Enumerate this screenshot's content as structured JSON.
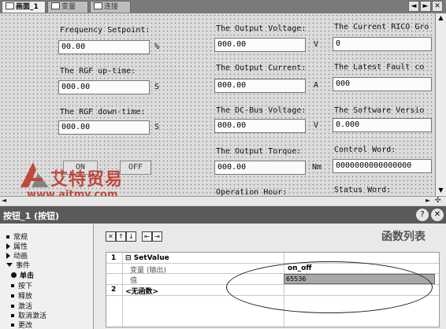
{
  "tabs": [
    {
      "label": "画面_1",
      "active": true
    },
    {
      "label": "变量",
      "active": false
    },
    {
      "label": "连接",
      "active": false
    }
  ],
  "window_controls": [
    "◄",
    "►",
    "✕"
  ],
  "form": {
    "col1": [
      {
        "label": "Frequency Setpoint:",
        "value": "00.00",
        "unit": "%"
      },
      {
        "label": "The RGF up-time:",
        "value": "000.00",
        "unit": "S"
      },
      {
        "label": "The RGF down-time:",
        "value": "000.00",
        "unit": "S"
      }
    ],
    "col2": [
      {
        "label": "The Output Voltage:",
        "value": "000.00",
        "unit": "V"
      },
      {
        "label": "The Output Current:",
        "value": "000.00",
        "unit": "A"
      },
      {
        "label": "The DC-Bus Voltage:",
        "value": "000.00",
        "unit": "V"
      },
      {
        "label": "The Output Torque:",
        "value": "000.00",
        "unit": "Nm"
      },
      {
        "label": "Operation Hour:",
        "value": "",
        "unit": ""
      }
    ],
    "col3": [
      {
        "label": "The Current RICO Gro",
        "value": "0"
      },
      {
        "label": "The Latest Fault co",
        "value": "000"
      },
      {
        "label": "The Software Versio",
        "value": "0.000"
      },
      {
        "label": "Control Word:",
        "value": "0000000000000000"
      },
      {
        "label": "Status Word:",
        "value": ""
      }
    ],
    "on_label": "ON",
    "off_label": "OFF"
  },
  "watermark": {
    "title": "艾特贸易",
    "url": "www.aitmy.com"
  },
  "properties": {
    "title": "按钮_1 (按钮)",
    "help_icon": "?",
    "close_icon": "✕",
    "tree": [
      {
        "label": "常规",
        "kind": "bullet"
      },
      {
        "label": "属性",
        "kind": "arrow"
      },
      {
        "label": "动画",
        "kind": "arrow"
      },
      {
        "label": "事件",
        "kind": "arrow-down"
      },
      {
        "label": "单击",
        "kind": "dot",
        "selected": true
      },
      {
        "label": "按下",
        "kind": "bullet"
      },
      {
        "label": "释放",
        "kind": "bullet"
      },
      {
        "label": "激活",
        "kind": "bullet"
      },
      {
        "label": "取消激活",
        "kind": "bullet"
      },
      {
        "label": "更改",
        "kind": "bullet"
      }
    ],
    "function_list_title": "函数列表",
    "toolbar_buttons": [
      "✕",
      "↑",
      "↓",
      "⇤",
      "⇥"
    ],
    "rows": [
      {
        "index": "1",
        "function": "SetValue",
        "params": [
          {
            "name": "变量 (输出)",
            "value": "on_off"
          },
          {
            "name": "值",
            "value": "65536"
          }
        ]
      },
      {
        "index": "2",
        "function": "<无函数>"
      }
    ]
  }
}
